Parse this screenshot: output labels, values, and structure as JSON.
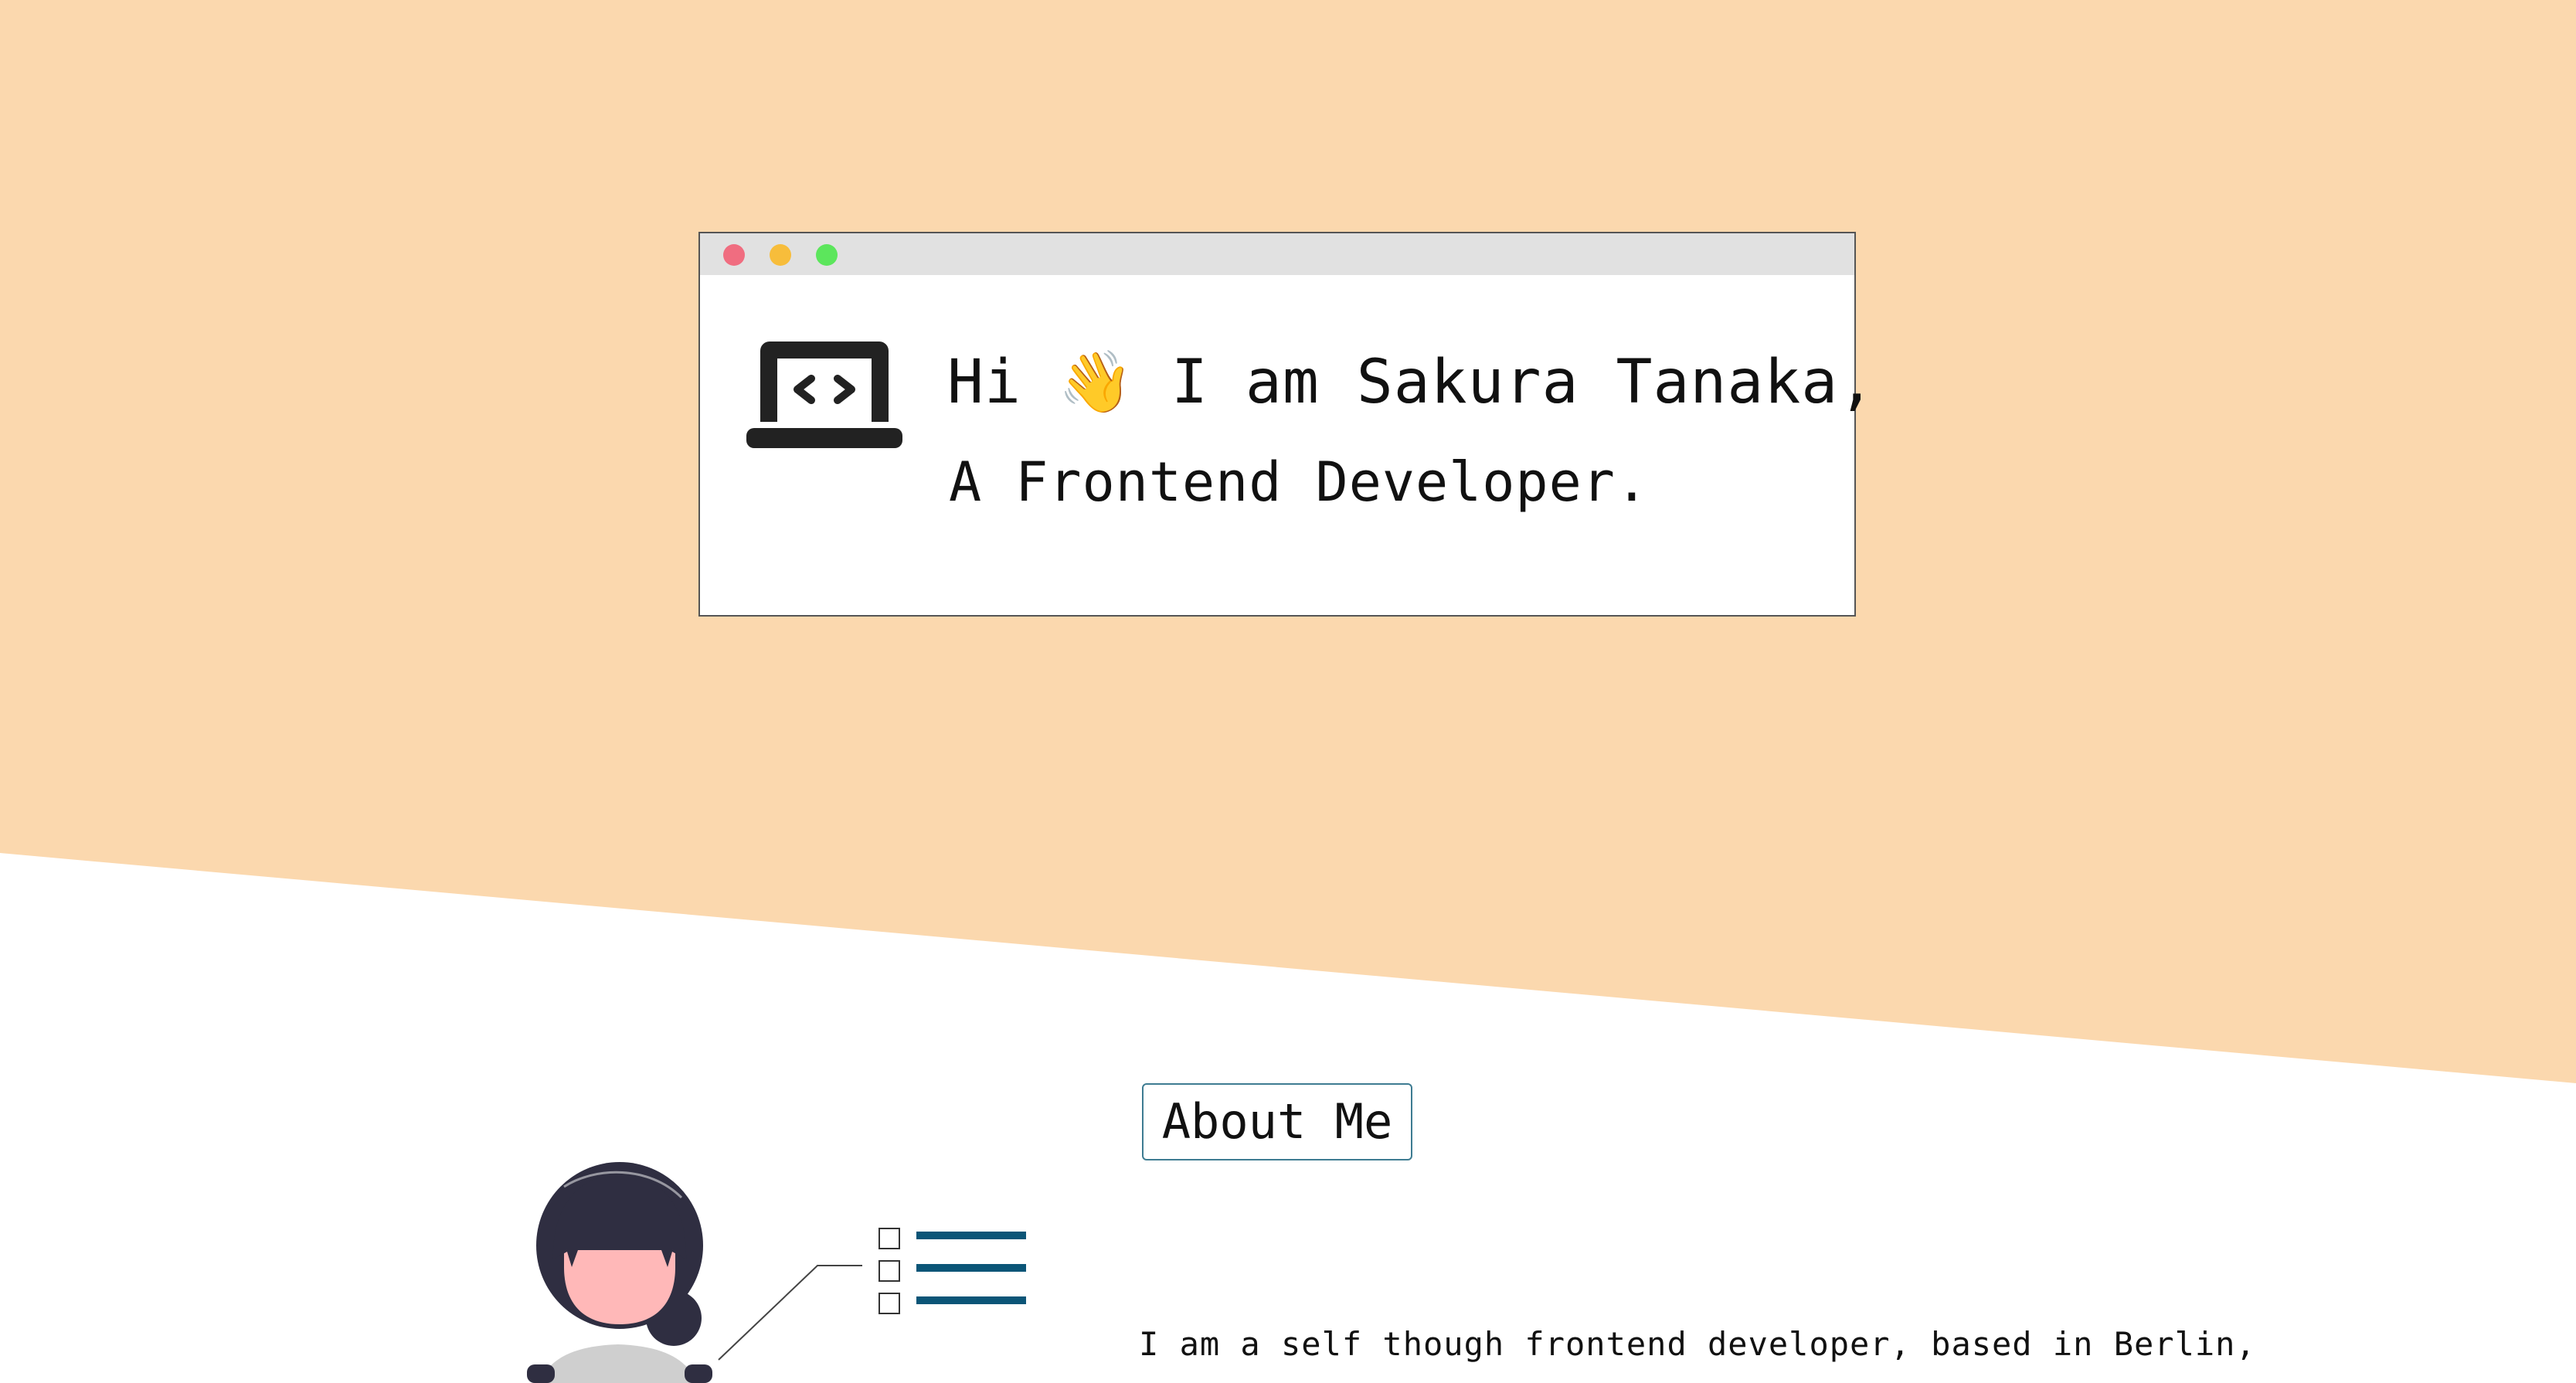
{
  "colors": {
    "hero_background": "#FBD8AE",
    "window_bar": "#E1E1E1",
    "dot_red": "#F06D80",
    "dot_yellow": "#F7BD3B",
    "dot_green": "#5CE65C",
    "about_border": "#3E7C92",
    "checklist_lines": "#0B5577",
    "hair": "#2F2E41",
    "skin": "#FFB8B8",
    "shirt": "#CFCFCF"
  },
  "icons": {
    "laptop": "laptop-code-icon",
    "wave": "waving-hand-emoji"
  },
  "hero": {
    "greeting_prefix": "Hi ",
    "wave_emoji": "👋",
    "greeting_suffix": " I am Sakura Tanaka,",
    "role": "A Frontend Developer."
  },
  "about": {
    "title": "About Me",
    "text": "I am a self though frontend developer, based in Berlin,"
  }
}
